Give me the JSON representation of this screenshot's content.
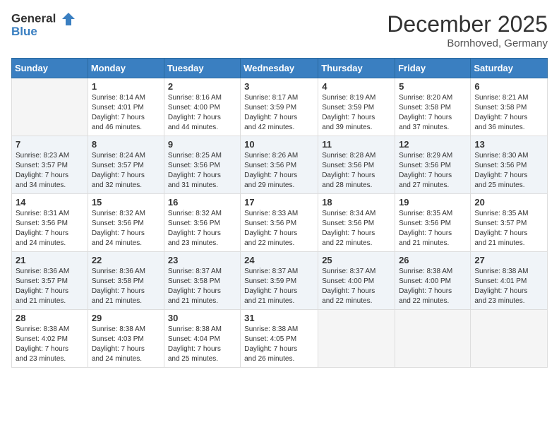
{
  "header": {
    "logo": {
      "general": "General",
      "blue": "Blue"
    },
    "title": "December 2025",
    "location": "Bornhoved, Germany"
  },
  "weekdays": [
    "Sunday",
    "Monday",
    "Tuesday",
    "Wednesday",
    "Thursday",
    "Friday",
    "Saturday"
  ],
  "weeks": [
    [
      {
        "day": "",
        "info": ""
      },
      {
        "day": "1",
        "info": "Sunrise: 8:14 AM\nSunset: 4:01 PM\nDaylight: 7 hours\nand 46 minutes."
      },
      {
        "day": "2",
        "info": "Sunrise: 8:16 AM\nSunset: 4:00 PM\nDaylight: 7 hours\nand 44 minutes."
      },
      {
        "day": "3",
        "info": "Sunrise: 8:17 AM\nSunset: 3:59 PM\nDaylight: 7 hours\nand 42 minutes."
      },
      {
        "day": "4",
        "info": "Sunrise: 8:19 AM\nSunset: 3:59 PM\nDaylight: 7 hours\nand 39 minutes."
      },
      {
        "day": "5",
        "info": "Sunrise: 8:20 AM\nSunset: 3:58 PM\nDaylight: 7 hours\nand 37 minutes."
      },
      {
        "day": "6",
        "info": "Sunrise: 8:21 AM\nSunset: 3:58 PM\nDaylight: 7 hours\nand 36 minutes."
      }
    ],
    [
      {
        "day": "7",
        "info": "Sunrise: 8:23 AM\nSunset: 3:57 PM\nDaylight: 7 hours\nand 34 minutes."
      },
      {
        "day": "8",
        "info": "Sunrise: 8:24 AM\nSunset: 3:57 PM\nDaylight: 7 hours\nand 32 minutes."
      },
      {
        "day": "9",
        "info": "Sunrise: 8:25 AM\nSunset: 3:56 PM\nDaylight: 7 hours\nand 31 minutes."
      },
      {
        "day": "10",
        "info": "Sunrise: 8:26 AM\nSunset: 3:56 PM\nDaylight: 7 hours\nand 29 minutes."
      },
      {
        "day": "11",
        "info": "Sunrise: 8:28 AM\nSunset: 3:56 PM\nDaylight: 7 hours\nand 28 minutes."
      },
      {
        "day": "12",
        "info": "Sunrise: 8:29 AM\nSunset: 3:56 PM\nDaylight: 7 hours\nand 27 minutes."
      },
      {
        "day": "13",
        "info": "Sunrise: 8:30 AM\nSunset: 3:56 PM\nDaylight: 7 hours\nand 25 minutes."
      }
    ],
    [
      {
        "day": "14",
        "info": "Sunrise: 8:31 AM\nSunset: 3:56 PM\nDaylight: 7 hours\nand 24 minutes."
      },
      {
        "day": "15",
        "info": "Sunrise: 8:32 AM\nSunset: 3:56 PM\nDaylight: 7 hours\nand 24 minutes."
      },
      {
        "day": "16",
        "info": "Sunrise: 8:32 AM\nSunset: 3:56 PM\nDaylight: 7 hours\nand 23 minutes."
      },
      {
        "day": "17",
        "info": "Sunrise: 8:33 AM\nSunset: 3:56 PM\nDaylight: 7 hours\nand 22 minutes."
      },
      {
        "day": "18",
        "info": "Sunrise: 8:34 AM\nSunset: 3:56 PM\nDaylight: 7 hours\nand 22 minutes."
      },
      {
        "day": "19",
        "info": "Sunrise: 8:35 AM\nSunset: 3:56 PM\nDaylight: 7 hours\nand 21 minutes."
      },
      {
        "day": "20",
        "info": "Sunrise: 8:35 AM\nSunset: 3:57 PM\nDaylight: 7 hours\nand 21 minutes."
      }
    ],
    [
      {
        "day": "21",
        "info": "Sunrise: 8:36 AM\nSunset: 3:57 PM\nDaylight: 7 hours\nand 21 minutes."
      },
      {
        "day": "22",
        "info": "Sunrise: 8:36 AM\nSunset: 3:58 PM\nDaylight: 7 hours\nand 21 minutes."
      },
      {
        "day": "23",
        "info": "Sunrise: 8:37 AM\nSunset: 3:58 PM\nDaylight: 7 hours\nand 21 minutes."
      },
      {
        "day": "24",
        "info": "Sunrise: 8:37 AM\nSunset: 3:59 PM\nDaylight: 7 hours\nand 21 minutes."
      },
      {
        "day": "25",
        "info": "Sunrise: 8:37 AM\nSunset: 4:00 PM\nDaylight: 7 hours\nand 22 minutes."
      },
      {
        "day": "26",
        "info": "Sunrise: 8:38 AM\nSunset: 4:00 PM\nDaylight: 7 hours\nand 22 minutes."
      },
      {
        "day": "27",
        "info": "Sunrise: 8:38 AM\nSunset: 4:01 PM\nDaylight: 7 hours\nand 23 minutes."
      }
    ],
    [
      {
        "day": "28",
        "info": "Sunrise: 8:38 AM\nSunset: 4:02 PM\nDaylight: 7 hours\nand 23 minutes."
      },
      {
        "day": "29",
        "info": "Sunrise: 8:38 AM\nSunset: 4:03 PM\nDaylight: 7 hours\nand 24 minutes."
      },
      {
        "day": "30",
        "info": "Sunrise: 8:38 AM\nSunset: 4:04 PM\nDaylight: 7 hours\nand 25 minutes."
      },
      {
        "day": "31",
        "info": "Sunrise: 8:38 AM\nSunset: 4:05 PM\nDaylight: 7 hours\nand 26 minutes."
      },
      {
        "day": "",
        "info": ""
      },
      {
        "day": "",
        "info": ""
      },
      {
        "day": "",
        "info": ""
      }
    ]
  ]
}
